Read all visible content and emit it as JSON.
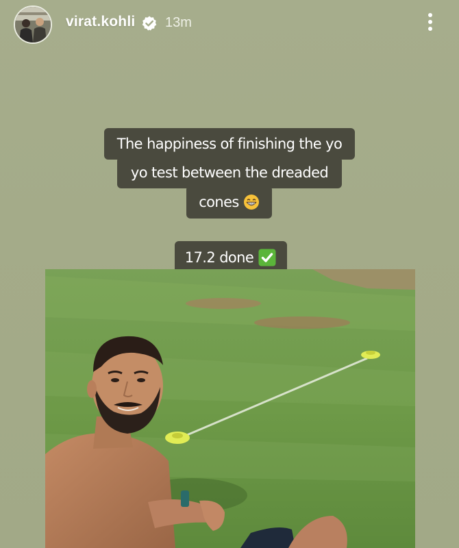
{
  "header": {
    "username": "virat.kohli",
    "timestamp": "13m",
    "avatar_icon": "profile-avatar",
    "verified_icon": "verified-badge-icon",
    "more_icon": "more-vertical-icon"
  },
  "captions": {
    "line1": "The happiness of finishing the yo",
    "line2": "yo test between the dreaded",
    "line3": "cones",
    "line3_emoji": "grinning-face-icon",
    "score": "17.2 done",
    "score_emoji": "check-mark-button-icon"
  },
  "photo": {
    "subject": "selfie-on-cricket-field-with-cones"
  },
  "colors": {
    "background": "#a4ab89",
    "caption_bg": "#4a4a3e",
    "caption_text": "#ffffff",
    "check_green": "#5bb53a",
    "grass": "#6f9a4a",
    "cone": "#d9e84a"
  }
}
